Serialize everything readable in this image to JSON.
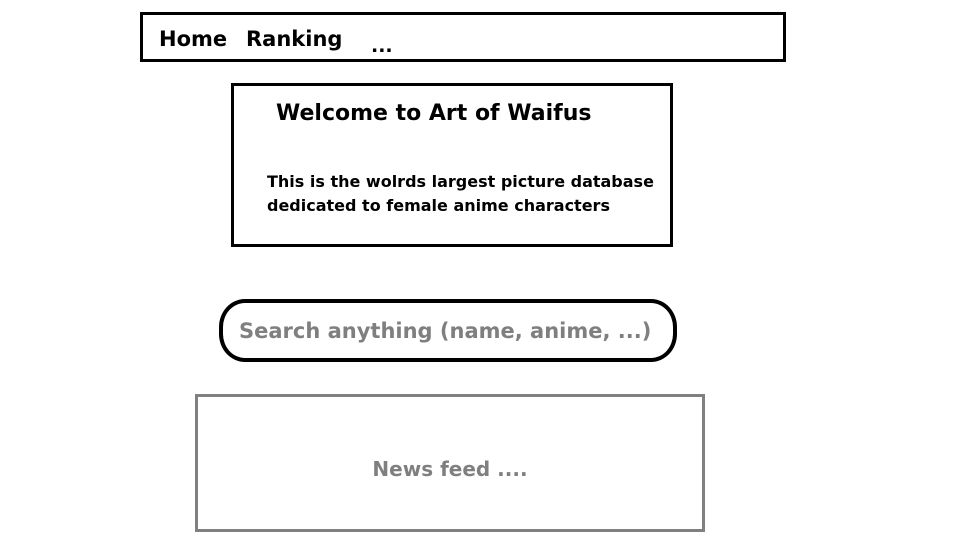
{
  "navbar": {
    "items": [
      {
        "label": "Home"
      },
      {
        "label": "Ranking"
      },
      {
        "label": "..."
      }
    ]
  },
  "welcome": {
    "title": "Welcome to Art of Waifus",
    "description": "This is the wolrds largest picture database dedicated to female anime characters"
  },
  "search": {
    "placeholder": "Search anything (name, anime, ...)",
    "value": ""
  },
  "news": {
    "label": "News feed ...."
  },
  "colors": {
    "border": "#000000",
    "muted_text": "#7f7f7f",
    "muted_border": "#808080",
    "background": "#ffffff"
  }
}
